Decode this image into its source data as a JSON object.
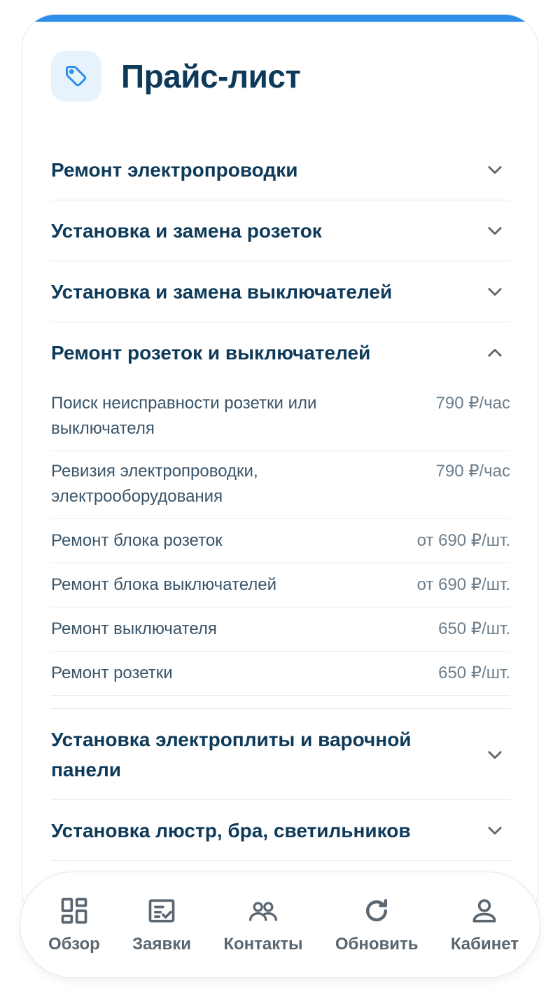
{
  "card": {
    "title": "Прайс-лист",
    "icon": "price-tag-icon",
    "accent_color": "#2f8fe8"
  },
  "sections": [
    {
      "title": "Ремонт электропроводки",
      "expanded": false
    },
    {
      "title": "Установка и замена розеток",
      "expanded": false
    },
    {
      "title": "Установка и замена выключателей",
      "expanded": false
    },
    {
      "title": "Ремонт розеток и выключателей",
      "expanded": true,
      "items": [
        {
          "name": "Поиск неисправности розетки или выключателя",
          "price": "790 ₽/час"
        },
        {
          "name": "Ревизия электропроводки, электрооборудования",
          "price": "790 ₽/час"
        },
        {
          "name": "Ремонт блока розеток",
          "price": "от 690 ₽/шт."
        },
        {
          "name": "Ремонт блока выключателей",
          "price": "от 690 ₽/шт."
        },
        {
          "name": "Ремонт выключателя",
          "price": "650 ₽/шт."
        },
        {
          "name": "Ремонт розетки",
          "price": "650 ₽/шт."
        }
      ]
    },
    {
      "title": "Установка электроплиты и варочной панели",
      "expanded": false
    },
    {
      "title": "Установка люстр, бра, светильников",
      "expanded": false
    }
  ],
  "nav": [
    {
      "label": "Обзор",
      "icon": "grid-icon"
    },
    {
      "label": "Заявки",
      "icon": "checklist-icon"
    },
    {
      "label": "Контакты",
      "icon": "people-icon"
    },
    {
      "label": "Обновить",
      "icon": "refresh-icon"
    },
    {
      "label": "Кабинет",
      "icon": "user-icon"
    }
  ]
}
